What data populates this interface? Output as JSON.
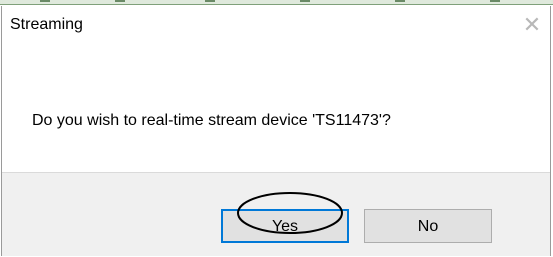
{
  "dialog": {
    "title": "Streaming",
    "close_icon": "close-icon",
    "message": "Do you wish to real-time stream device 'TS11473'?",
    "buttons": {
      "yes_label": "Yes",
      "no_label": "No"
    },
    "colors": {
      "focus_border": "#0078d7",
      "footer_bg": "#f0f0f0",
      "button_bg": "#e1e1e1"
    }
  }
}
